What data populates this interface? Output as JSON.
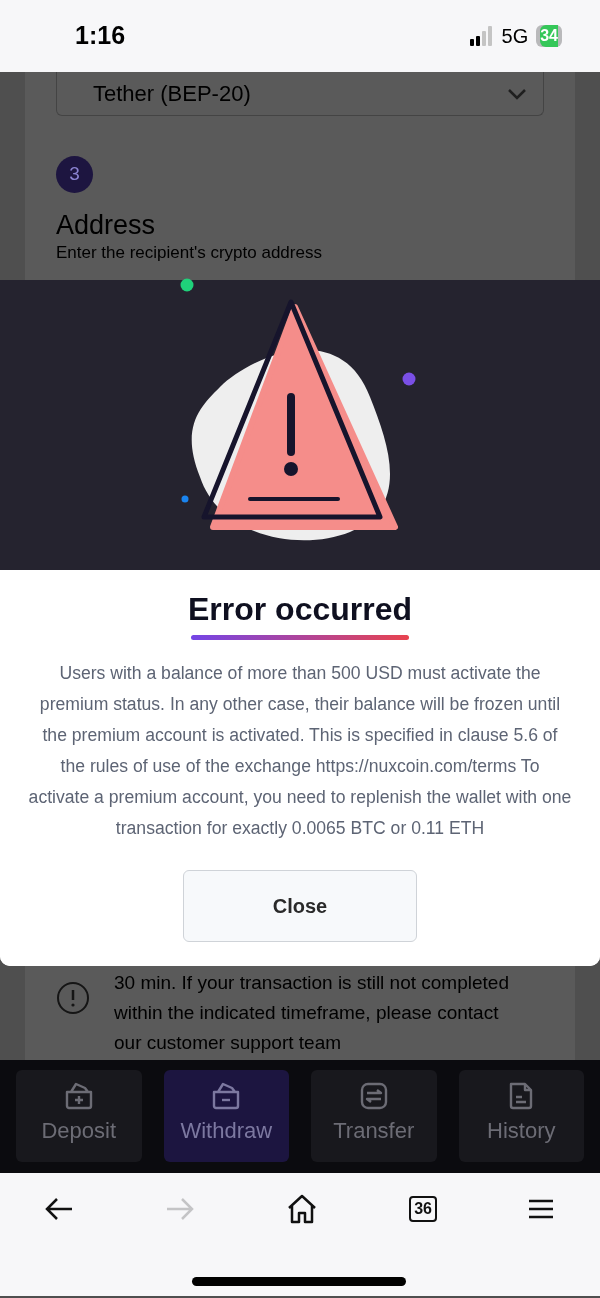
{
  "status_bar": {
    "time": "1:16",
    "network": "5G",
    "battery": "34"
  },
  "page": {
    "network_select": {
      "value": "Tether (BEP-20)"
    },
    "step": {
      "number": "3",
      "title": "Address",
      "subtitle": "Enter the recipient's crypto address"
    },
    "notice": {
      "text": "30 min. If your transaction is still not completed within the indicated timeframe, please contact our customer support team"
    }
  },
  "dialog": {
    "title": "Error occurred",
    "message": "Users with a balance of more than 500 USD must activate the premium status. In any other case, their balance will be frozen until the premium account is activated. This is specified in clause 5.6 of the rules of use of the exchange https://nuxcoin.com/terms To activate a premium account, you need to replenish the wallet with one transaction for exactly 0.0065 BTC or 0.11 ETH",
    "button": "Close"
  },
  "bottom_nav": [
    {
      "kind": "deposit",
      "label": "Deposit",
      "selected": false
    },
    {
      "kind": "withdraw",
      "label": "Withdraw",
      "selected": true
    },
    {
      "kind": "transfer",
      "label": "Transfer",
      "selected": false
    },
    {
      "kind": "history",
      "label": "History",
      "selected": false
    }
  ],
  "browser_toolbar": {
    "forward_disabled": true,
    "tab_count": "36"
  }
}
